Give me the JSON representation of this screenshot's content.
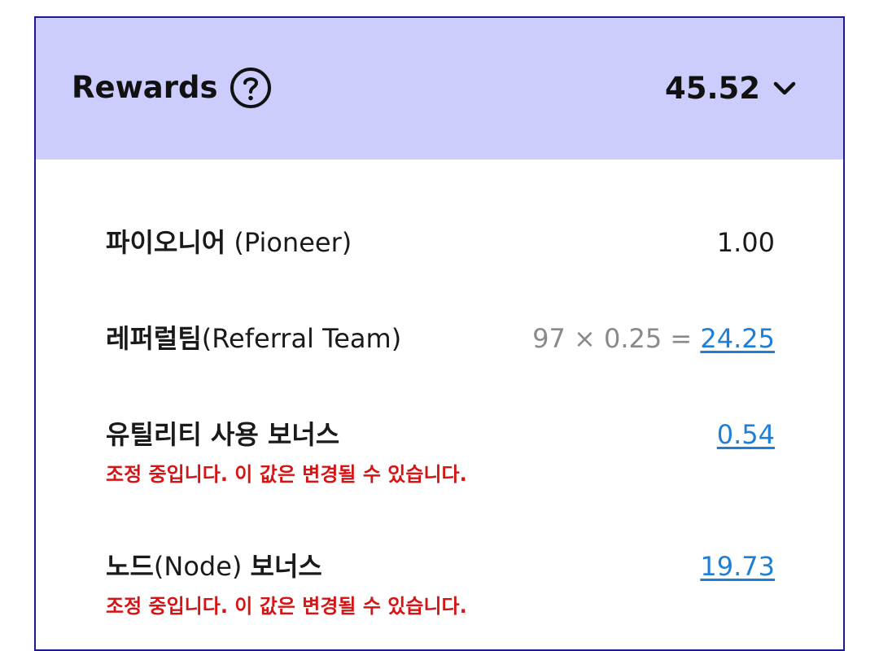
{
  "header": {
    "title": "Rewards",
    "total": "45.52",
    "help_icon": "question-circle-icon",
    "expand_icon": "chevron-down-icon",
    "background_color": "#cdcdfd",
    "border_color": "#1d1a8f"
  },
  "rows": [
    {
      "label_ko": "파이오니어",
      "label_en": " (Pioneer)",
      "value": "1.00"
    },
    {
      "label_ko": "레퍼럴팀",
      "label_en": "(Referral Team)",
      "formula": "97 × 0.25 = ",
      "value": "24.25"
    },
    {
      "label_ko": "유틸리티 사용 보너스",
      "value": "0.54",
      "warning": "조정 중입니다. 이 값은 변경될 수 있습니다."
    },
    {
      "label_ko": "노드",
      "label_en": "(Node) ",
      "label_ko_suffix": "보너스",
      "value": "19.73",
      "warning": "조정 중입니다. 이 값은 변경될 수 있습니다."
    }
  ],
  "colors": {
    "link": "#1e7fd6",
    "warning": "#d41515",
    "formula": "#8a8a8a"
  }
}
